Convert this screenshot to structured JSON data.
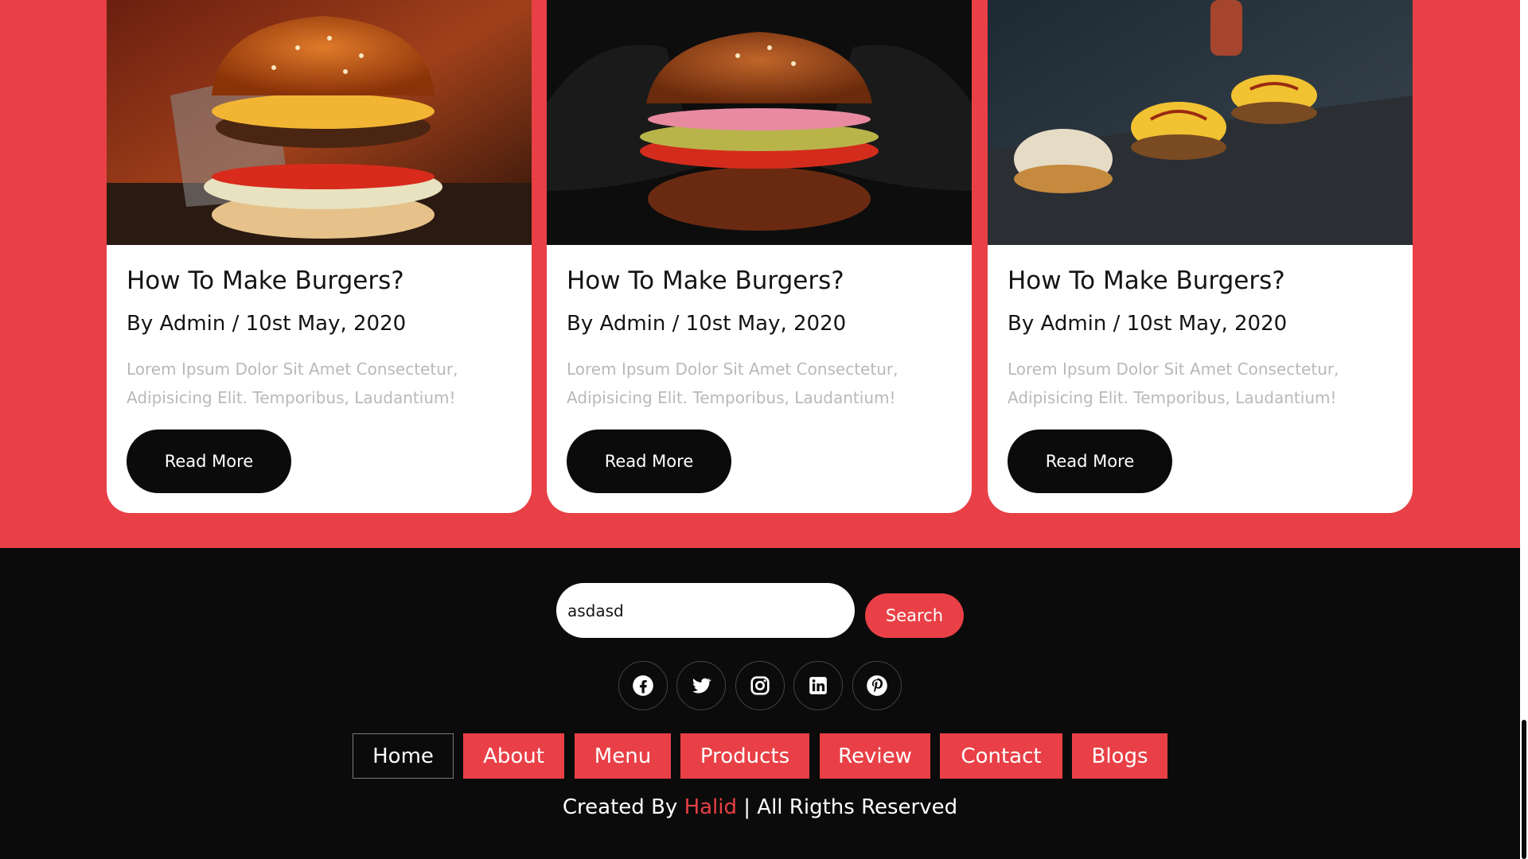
{
  "blogs": [
    {
      "image": "burger-on-table-photo",
      "title": "How To Make Burgers?",
      "meta": "By Admin / 10st May, 2020",
      "description": "Lorem Ipsum Dolor Sit Amet Consectetur, Adipisicing Elit. Temporibus, Laudantium!",
      "button_label": "Read More"
    },
    {
      "image": "burger-held-in-gloves-photo",
      "title": "How To Make Burgers?",
      "meta": "By Admin / 10st May, 2020",
      "description": "Lorem Ipsum Dolor Sit Amet Consectetur, Adipisicing Elit. Temporibus, Laudantium!",
      "button_label": "Read More"
    },
    {
      "image": "sliders-on-grill-photo",
      "title": "How To Make Burgers?",
      "meta": "By Admin / 10st May, 2020",
      "description": "Lorem Ipsum Dolor Sit Amet Consectetur, Adipisicing Elit. Temporibus, Laudantium!",
      "button_label": "Read More"
    }
  ],
  "search": {
    "value": "asdasd",
    "button_label": "Search"
  },
  "social": [
    "facebook-icon",
    "twitter-icon",
    "instagram-icon",
    "linkedin-icon",
    "pinterest-icon"
  ],
  "nav": [
    {
      "label": "Home",
      "active": true
    },
    {
      "label": "About",
      "active": false
    },
    {
      "label": "Menu",
      "active": false
    },
    {
      "label": "Products",
      "active": false
    },
    {
      "label": "Review",
      "active": false
    },
    {
      "label": "Contact",
      "active": false
    },
    {
      "label": "Blogs",
      "active": false
    }
  ],
  "footer": {
    "created_prefix": "Created By ",
    "author": "Halid",
    "rights_suffix": " | All Rigths Reserved"
  },
  "colors": {
    "accent": "#e84046",
    "dark": "#0b0b0b",
    "card": "#ffffff",
    "muted_text": "#b9b9b9"
  }
}
